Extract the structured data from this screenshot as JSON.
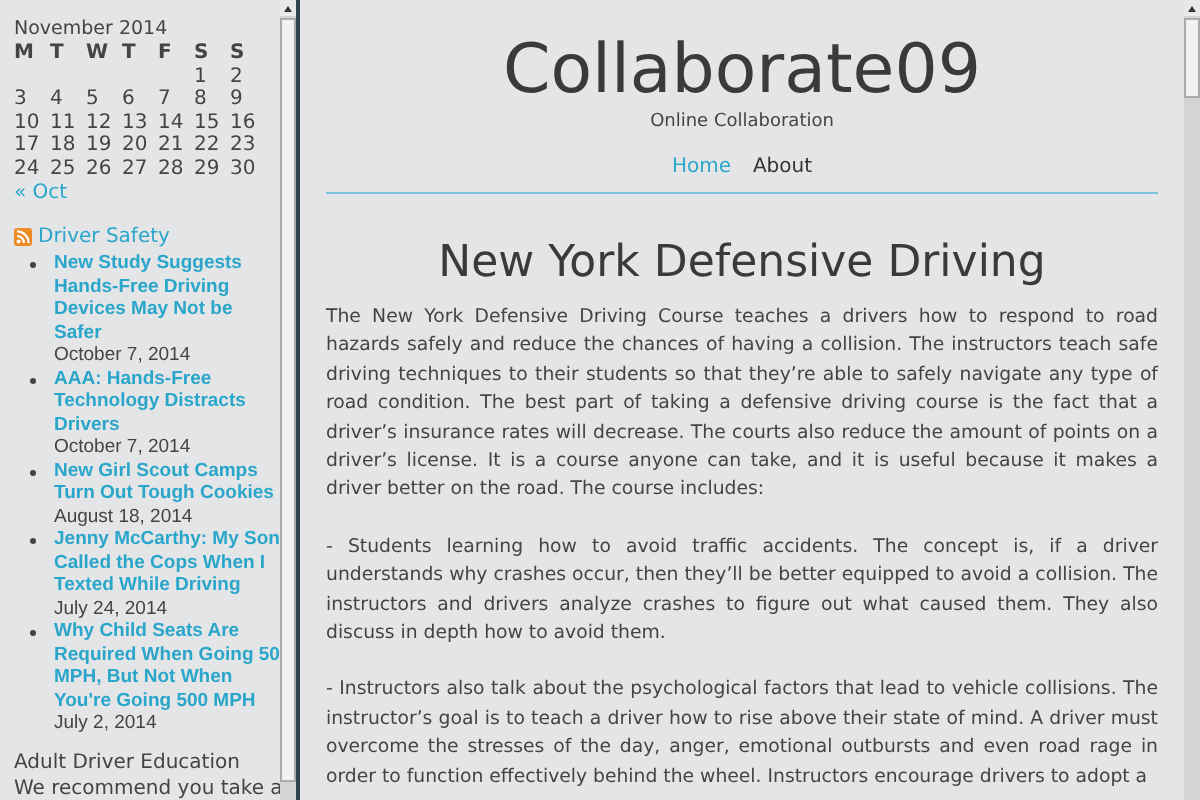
{
  "sidebar": {
    "calendar": {
      "caption": "November 2014",
      "weekdays": [
        "M",
        "T",
        "W",
        "T",
        "F",
        "S",
        "S"
      ],
      "weeks": [
        [
          "1",
          "2"
        ],
        [
          "3",
          "4",
          "5",
          "6",
          "7",
          "8",
          "9"
        ],
        [
          "10",
          "11",
          "12",
          "13",
          "14",
          "15",
          "16"
        ],
        [
          "17",
          "18",
          "19",
          "20",
          "21",
          "22",
          "23"
        ],
        [
          "24",
          "25",
          "26",
          "27",
          "28",
          "29",
          "30"
        ]
      ],
      "prev_link": "« Oct"
    },
    "feed": {
      "title": "Driver Safety",
      "items": [
        {
          "title": "New Study Suggests Hands-Free Driving Devices May Not be Safer",
          "date": "October 7, 2014"
        },
        {
          "title": "AAA: Hands-Free Technology Distracts Drivers",
          "date": "October 7, 2014"
        },
        {
          "title": "New Girl Scout Camps Turn Out Tough Cookies",
          "date": "August 18, 2014"
        },
        {
          "title": "Jenny McCarthy: My Son Called the Cops When I Texted While Driving",
          "date": "July 24, 2014"
        },
        {
          "title": "Why Child Seats Are Required When Going 50 MPH, But Not When You're Going 500 MPH",
          "date": "July 2, 2014"
        }
      ]
    },
    "text_widget": {
      "title": "Adult Driver Education",
      "text": "We recommend you take a"
    }
  },
  "header": {
    "site_title": "Collaborate09",
    "tagline": "Online Collaboration",
    "nav": [
      {
        "label": "Home",
        "selected": true
      },
      {
        "label": "About",
        "selected": false
      }
    ]
  },
  "post": {
    "title": "New York Defensive Driving",
    "paragraphs": [
      "The New York Defensive Driving Course teaches a drivers how to respond to road hazards safely and reduce the chances of having a collision. The instructors teach safe driving techniques to their students so that they’re able to safely navigate any type of road condition. The best part of taking a defensive driving course is the fact that a driver’s insurance rates will decrease. The courts also reduce the amount of points on a driver’s license. It is a course anyone can take, and it is useful because it makes a driver better on the road. The course includes:",
      "- Students learning how to avoid traffic accidents. The concept is, if a driver understands why crashes occur, then they’ll be better equipped to avoid a collision. The instructors and drivers analyze crashes to figure out what caused them. They also discuss in depth how to avoid them.",
      "- Instructors also talk about the psychological factors that lead to vehicle collisions. The instructor’s goal is to teach a driver how to rise above their state of mind. A driver must overcome the stresses of the day, anger, emotional outbursts and even road rage in order to function effectively behind the wheel. Instructors encourage drivers to adopt a"
    ]
  }
}
